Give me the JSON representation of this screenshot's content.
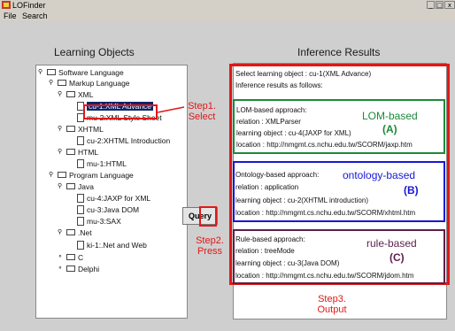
{
  "window": {
    "title": "LOFinder",
    "controls": {
      "minimize": "_",
      "maximize": "□",
      "close": "x"
    }
  },
  "menu": {
    "items": [
      "File",
      "Search"
    ]
  },
  "left_panel": {
    "title": "Learning Objects"
  },
  "right_panel": {
    "title": "Inference Results"
  },
  "tree": {
    "software_language": "Software Language",
    "markup_language": "Markup Language",
    "xml": "XML",
    "xml_advance": "cu-1:XML Advance",
    "xml_style": "mu-2:XML Style Sheet",
    "xhtml": "XHTML",
    "xhtml_intro": "cu-2:XHTML Introduction",
    "html": "HTML",
    "html_mu": "mu-1:HTML",
    "program_language": "Program Language",
    "java": "Java",
    "jaxp": "cu-4:JAXP for XML",
    "java_dom": "cu-3:Java DOM",
    "sax": "mu-3:SAX",
    "net": ".Net",
    "ki_net": "ki-1:.Net and Web",
    "c": "C",
    "delphi": "Delphi"
  },
  "query_button": {
    "label": "Query"
  },
  "steps": {
    "step1": [
      "Step1.",
      "Select"
    ],
    "step2": [
      "Step2.",
      "Press"
    ],
    "step3": [
      "Step3.",
      "Output"
    ]
  },
  "results": {
    "header": [
      "Select learning object : cu-1(XML Advance)",
      "Inference results as follows:"
    ],
    "lom": {
      "lines": [
        "LOM-based approach:",
        "relation : XMLParser",
        "learning object : cu-4(JAXP for XML)",
        "location : http://nmgmt.cs.nchu.edu.tw/SCORM/jaxp.htm"
      ],
      "label": "LOM-based",
      "tag": "(A)",
      "color": "#1c8a3a"
    },
    "ontology": {
      "lines": [
        "Ontology-based approach:",
        "relation : application",
        "learning object : cu-2(XHTML introduction)",
        "location : http://nmgmt.cs.nchu.edu.tw/SCORM/xhtml.htm"
      ],
      "label": "ontology-based",
      "tag": "(B)",
      "color": "#1717d8"
    },
    "rule": {
      "lines": [
        "Rule-based approach:",
        "relation : treeMode",
        "learning object : cu-3(Java DOM)",
        "location : http://nmgmt.cs.nchu.edu.tw/SCORM/jdom.htm"
      ],
      "label": "rule-based",
      "tag": "(C)",
      "color": "#5c1f4a"
    }
  },
  "colors": {
    "highlight_red": "#e01818",
    "selection": "#0a246a"
  }
}
